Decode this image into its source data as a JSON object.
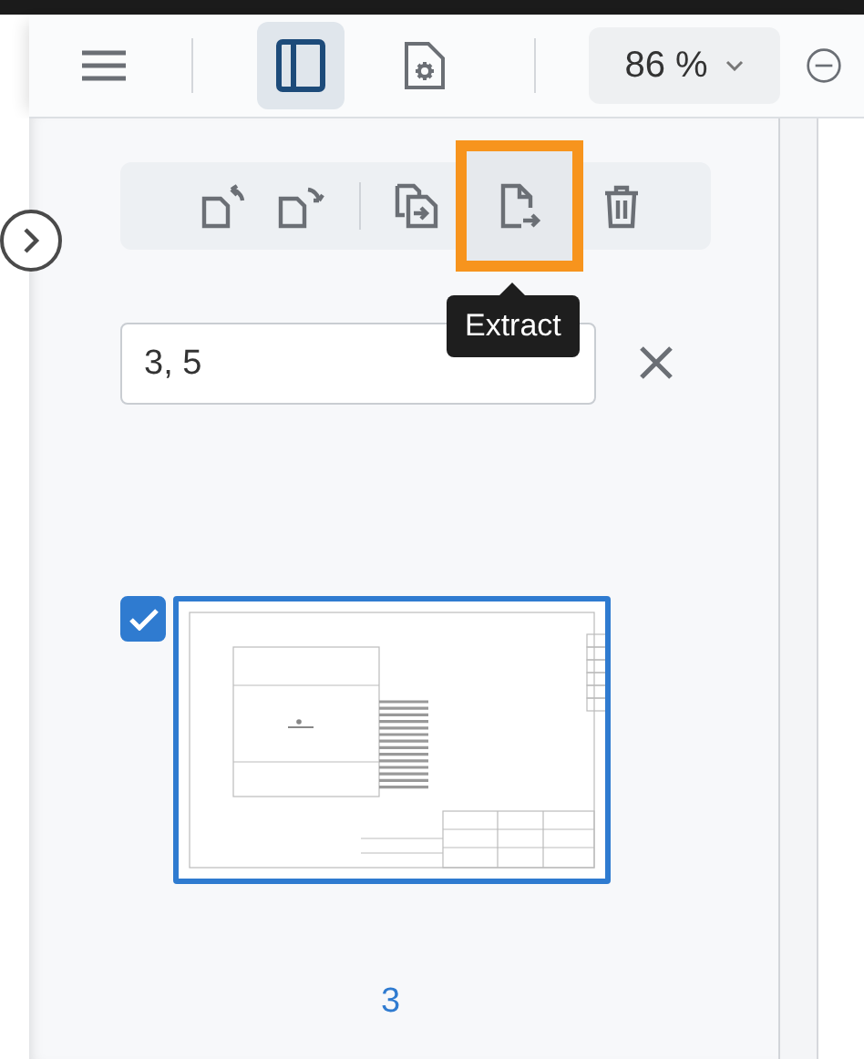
{
  "toolbar": {
    "sidebar_toggle": {
      "selected": true
    },
    "zoom": "86 %"
  },
  "page_actions": [
    {
      "kind": "rotate-left",
      "highlighted": false
    },
    {
      "kind": "rotate-right",
      "highlighted": false
    },
    {
      "kind": "separator"
    },
    {
      "kind": "merge",
      "highlighted": false
    },
    {
      "kind": "extract",
      "highlighted": true
    },
    {
      "kind": "delete",
      "highlighted": false
    }
  ],
  "tooltip": "Extract",
  "page_range": {
    "value": "3, 5"
  },
  "pages": [
    {
      "number": "3",
      "selected": true
    }
  ]
}
